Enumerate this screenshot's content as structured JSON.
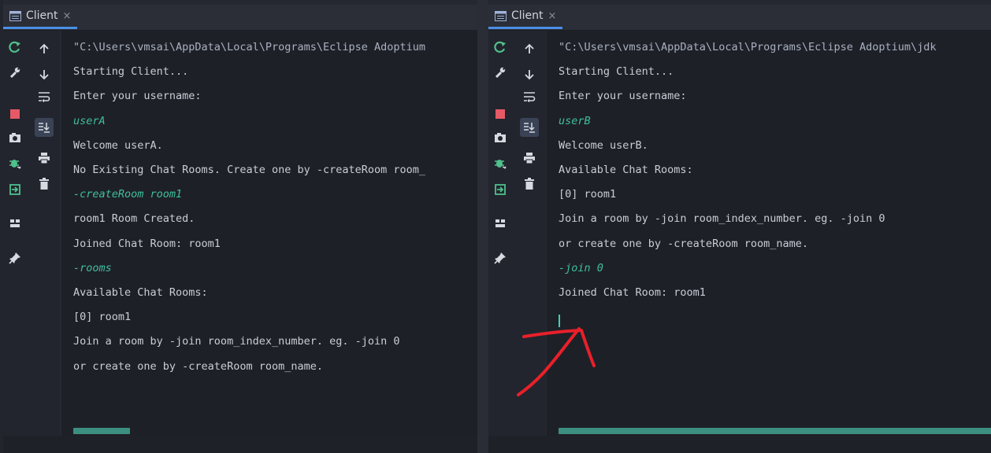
{
  "tabs": {
    "left_label": "Client",
    "right_label": "Client",
    "close_glyph": "×"
  },
  "left_console": {
    "lines": [
      {
        "text": "\"C:\\Users\\vmsai\\AppData\\Local\\Programs\\Eclipse Adoptium",
        "kind": "cmd"
      },
      {
        "text": "Starting Client...",
        "kind": "out"
      },
      {
        "text": "Enter your username:",
        "kind": "out"
      },
      {
        "text": "userA",
        "kind": "input"
      },
      {
        "text": "Welcome userA.",
        "kind": "out"
      },
      {
        "text": "No Existing Chat Rooms. Create one by -createRoom room_",
        "kind": "out"
      },
      {
        "text": "-createRoom room1",
        "kind": "input"
      },
      {
        "text": "room1 Room Created.",
        "kind": "out"
      },
      {
        "text": "Joined Chat Room: room1",
        "kind": "out"
      },
      {
        "text": "-rooms",
        "kind": "input"
      },
      {
        "text": "Available Chat Rooms:",
        "kind": "out"
      },
      {
        "text": "[0] room1",
        "kind": "out"
      },
      {
        "text": "Join a room by -join room_index_number. eg. -join 0",
        "kind": "out"
      },
      {
        "text": "or create one by -createRoom room_name.",
        "kind": "out"
      }
    ]
  },
  "right_console": {
    "lines": [
      {
        "text": "\"C:\\Users\\vmsai\\AppData\\Local\\Programs\\Eclipse Adoptium\\jdk",
        "kind": "cmd"
      },
      {
        "text": "Starting Client...",
        "kind": "out"
      },
      {
        "text": "Enter your username:",
        "kind": "out"
      },
      {
        "text": "userB",
        "kind": "input"
      },
      {
        "text": "Welcome userB.",
        "kind": "out"
      },
      {
        "text": "Available Chat Rooms:",
        "kind": "out"
      },
      {
        "text": "[0] room1",
        "kind": "out"
      },
      {
        "text": "Join a room by -join room_index_number. eg. -join 0",
        "kind": "out"
      },
      {
        "text": "or create one by -createRoom room_name.",
        "kind": "out"
      },
      {
        "text": "-join 0",
        "kind": "input"
      },
      {
        "text": "Joined Chat Room: room1",
        "kind": "out"
      }
    ]
  },
  "colors": {
    "background": "#22252d",
    "console_bg": "#1e2028",
    "output_text": "#c9cdd6",
    "input_text": "#3fbf9f",
    "tab_underline": "#4a8fe7",
    "annotation_arrow": "#e8202a",
    "scrollbar": "#3c8f80"
  },
  "icons": {
    "left_column": [
      "rerun-icon",
      "settings-wrench-icon",
      "stop-icon",
      "camera-icon",
      "debug-bug-icon",
      "exit-icon",
      "layout-icon",
      "pin-icon"
    ],
    "right_column": [
      "up-arrow-icon",
      "down-arrow-icon",
      "soft-wrap-icon",
      "scroll-to-end-icon",
      "print-icon",
      "trash-icon"
    ]
  },
  "annotation": {
    "type": "hand-drawn-arrow",
    "points_to": "cursor-in-right-console"
  }
}
